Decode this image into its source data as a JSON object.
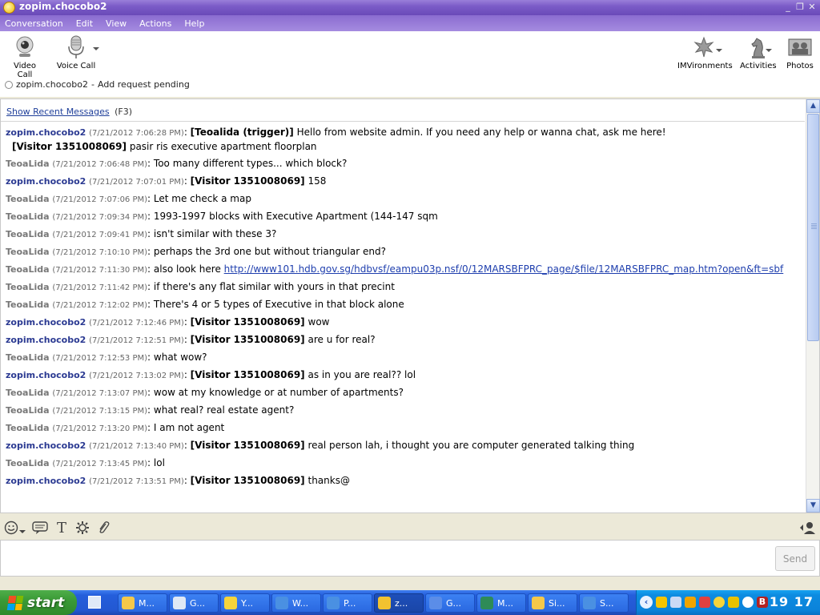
{
  "window": {
    "title": "zopim.chocobo2",
    "controls": [
      "_",
      "❐",
      "✕"
    ]
  },
  "menu": [
    {
      "label": "Conversation"
    },
    {
      "label": "Edit"
    },
    {
      "label": "View"
    },
    {
      "label": "Actions"
    },
    {
      "label": "Help"
    }
  ],
  "toolbar": {
    "video_call": "Video Call",
    "voice_call": "Voice Call",
    "imvironments": "IMVironments",
    "activities": "Activities",
    "photos": "Photos"
  },
  "status": {
    "contact": "zopim.chocobo2",
    "separator": "-",
    "text": "Add request pending"
  },
  "recent": {
    "link": "Show Recent Messages",
    "shortcut": "(F3)"
  },
  "messages": [
    {
      "sender": "zopim.chocobo2",
      "time": "(7/21/2012 7:06:28 PM)",
      "visitor": "[Teoalida (trigger)]",
      "text": "Hello from website admin. If you need any help or wanna chat, ask me here!",
      "cont_visitor": "[Visitor 1351008069]",
      "cont_text": "pasir ris executive apartment floorplan"
    },
    {
      "sender": "TeoaLida",
      "time": "(7/21/2012 7:06:48 PM)",
      "text": "Too many different types... which block?"
    },
    {
      "sender": "zopim.chocobo2",
      "time": "(7/21/2012 7:07:01 PM)",
      "visitor": "[Visitor 1351008069]",
      "text": "158"
    },
    {
      "sender": "TeoaLida",
      "time": "(7/21/2012 7:07:06 PM)",
      "text": "Let me check a map"
    },
    {
      "sender": "TeoaLida",
      "time": "(7/21/2012 7:09:34 PM)",
      "text": "1993-1997 blocks with Executive Apartment (144-147 sqm"
    },
    {
      "sender": "TeoaLida",
      "time": "(7/21/2012 7:09:41 PM)",
      "text": "isn't similar with these 3?"
    },
    {
      "sender": "TeoaLida",
      "time": "(7/21/2012 7:10:10 PM)",
      "text": "perhaps the 3rd one but without triangular end?"
    },
    {
      "sender": "TeoaLida",
      "time": "(7/21/2012 7:11:30 PM)",
      "text": "also look here",
      "link": "http://www101.hdb.gov.sg/hdbvsf/eampu03p.nsf/0/12MARSBFPRC_page/$file/12MARSBFPRC_map.htm?open&ft=sbf"
    },
    {
      "sender": "TeoaLida",
      "time": "(7/21/2012 7:11:42 PM)",
      "text": "if there's any flat similar with yours in that precint"
    },
    {
      "sender": "TeoaLida",
      "time": "(7/21/2012 7:12:02 PM)",
      "text": "There's 4 or 5 types of Executive in that block alone"
    },
    {
      "sender": "zopim.chocobo2",
      "time": "(7/21/2012 7:12:46 PM)",
      "visitor": "[Visitor 1351008069]",
      "text": "wow"
    },
    {
      "sender": "zopim.chocobo2",
      "time": "(7/21/2012 7:12:51 PM)",
      "visitor": "[Visitor 1351008069]",
      "text": "are u for real?"
    },
    {
      "sender": "TeoaLida",
      "time": "(7/21/2012 7:12:53 PM)",
      "text": "what wow?"
    },
    {
      "sender": "zopim.chocobo2",
      "time": "(7/21/2012 7:13:02 PM)",
      "visitor": "[Visitor 1351008069]",
      "text": "as in you are real?? lol"
    },
    {
      "sender": "TeoaLida",
      "time": "(7/21/2012 7:13:07 PM)",
      "text": "wow at my knowledge or at number of apartments?"
    },
    {
      "sender": "TeoaLida",
      "time": "(7/21/2012 7:13:15 PM)",
      "text": "what real? real estate agent?"
    },
    {
      "sender": "TeoaLida",
      "time": "(7/21/2012 7:13:20 PM)",
      "text": "I am not agent"
    },
    {
      "sender": "zopim.chocobo2",
      "time": "(7/21/2012 7:13:40 PM)",
      "visitor": "[Visitor 1351008069]",
      "text": "real person lah, i thought you are computer generated talking thing"
    },
    {
      "sender": "TeoaLida",
      "time": "(7/21/2012 7:13:45 PM)",
      "text": "lol"
    },
    {
      "sender": "zopim.chocobo2",
      "time": "(7/21/2012 7:13:51 PM)",
      "visitor": "[Visitor 1351008069]",
      "text": "thanks@"
    }
  ],
  "input": {
    "send_label": "Send"
  },
  "taskbar": {
    "start_label": "start",
    "tasks": [
      {
        "label": "M...",
        "color": "#f5c84a"
      },
      {
        "label": "G...",
        "color": "#dfe8f5"
      },
      {
        "label": "Y...",
        "color": "#f7d43a"
      },
      {
        "label": "W...",
        "color": "#4a90e2"
      },
      {
        "label": "P...",
        "color": "#4a90e2"
      },
      {
        "label": "z...",
        "color": "#f2c230"
      },
      {
        "label": "G...",
        "color": "#5b8de8"
      },
      {
        "label": "M...",
        "color": "#2e8b57"
      },
      {
        "label": "Si...",
        "color": "#f5c84a"
      },
      {
        "label": "S...",
        "color": "#4a90e2"
      }
    ],
    "clock": "19 17"
  },
  "colors": {
    "admin_sender": "#2b3a92",
    "teo_sender": "#777777",
    "link": "#1f3fae"
  }
}
